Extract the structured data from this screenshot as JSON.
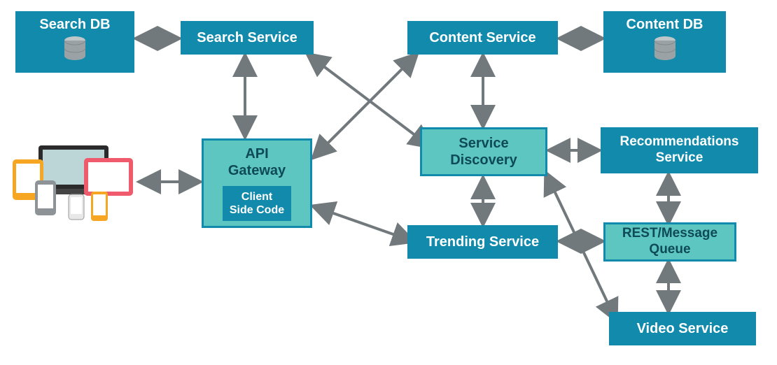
{
  "nodes": {
    "search_db": "Search DB",
    "search_service": "Search Service",
    "content_service": "Content Service",
    "content_db": "Content DB",
    "api_gateway": "API\nGateway",
    "client_side_code": "Client\nSide Code",
    "service_discovery": "Service\nDiscovery",
    "recommendations_service": "Recommendations\nService",
    "trending_service": "Trending Service",
    "rest_message_queue": "REST/Message\nQueue",
    "video_service": "Video Service"
  },
  "colors": {
    "dark": "#118aab",
    "light": "#5ec6c0",
    "arrow": "#72797d"
  },
  "edges": [
    [
      "search_db",
      "search_service",
      "bi"
    ],
    [
      "content_service",
      "content_db",
      "bi"
    ],
    [
      "search_service",
      "api_gateway",
      "bi"
    ],
    [
      "devices",
      "api_gateway",
      "bi"
    ],
    [
      "search_service",
      "service_discovery",
      "bi"
    ],
    [
      "content_service",
      "api_gateway",
      "bi"
    ],
    [
      "content_service",
      "service_discovery",
      "bi"
    ],
    [
      "service_discovery",
      "recommendations_service",
      "bi"
    ],
    [
      "service_discovery",
      "trending_service",
      "bi"
    ],
    [
      "api_gateway",
      "trending_service",
      "bi"
    ],
    [
      "trending_service",
      "rest_message_queue",
      "bi"
    ],
    [
      "recommendations_service",
      "rest_message_queue",
      "bi"
    ],
    [
      "rest_message_queue",
      "video_service",
      "bi"
    ],
    [
      "service_discovery",
      "video_service",
      "bi"
    ]
  ]
}
